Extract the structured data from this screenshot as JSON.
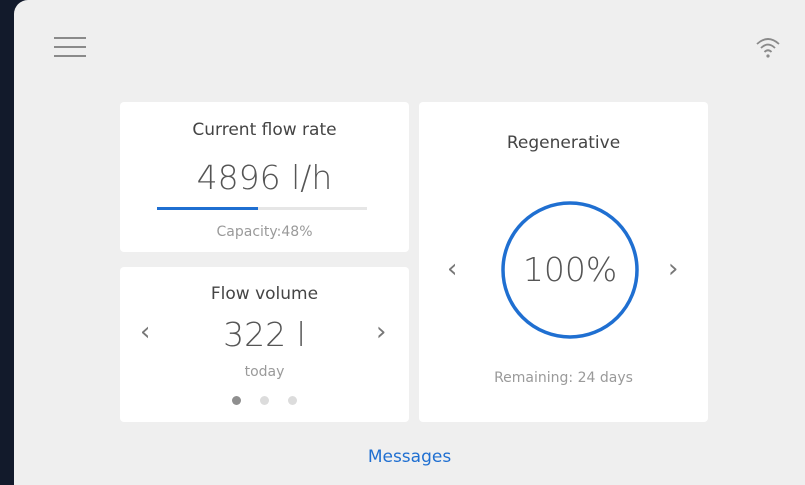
{
  "header": {
    "menu_icon": "hamburger-menu-icon",
    "status_icon": "wifi-icon"
  },
  "flow_rate": {
    "title": "Current flow rate",
    "value": "4896 l/h",
    "capacity_text": "Capacity:48%",
    "capacity_fraction": 0.48
  },
  "flow_volume": {
    "title": "Flow volume",
    "value": "322 l",
    "period": "today",
    "prev_icon": "chevron-left-icon",
    "next_icon": "chevron-right-icon",
    "pages": 3,
    "active_page": 1
  },
  "regenerative": {
    "title": "Regenerative",
    "value": "100%",
    "remaining": "Remaining: 24 days",
    "prev_icon": "chevron-left-icon",
    "next_icon": "chevron-right-icon"
  },
  "footer": {
    "messages_label": "Messages"
  },
  "colors": {
    "accent": "#1f6fd1",
    "background": "#efefef",
    "card": "#ffffff"
  }
}
